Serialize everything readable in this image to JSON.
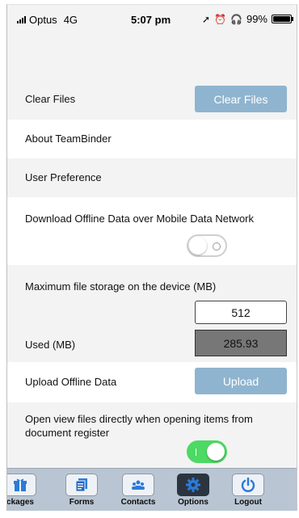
{
  "status_bar": {
    "carrier": "Optus",
    "network": "4G",
    "time": "5:07 pm",
    "battery": "99%",
    "battery_level": 0.99
  },
  "rows": {
    "clear_files": {
      "label": "Clear Files",
      "button": "Clear Files"
    },
    "about": {
      "label": "About TeamBinder"
    },
    "user_preference": {
      "label": "User Preference"
    },
    "download_offline": {
      "label": "Download Offline Data over Mobile Data Network",
      "enabled": false
    },
    "max_storage": {
      "label": "Maximum file storage on the device (MB)",
      "value": "512"
    },
    "used": {
      "label": "Used (MB)",
      "value": "285.93"
    },
    "upload_offline": {
      "label": "Upload Offline Data",
      "button": "Upload"
    },
    "open_view": {
      "label": "Open view files directly when opening items from document register",
      "enabled": true
    }
  },
  "tabs": [
    {
      "label": "ckages",
      "icon": "packages-icon"
    },
    {
      "label": "Forms",
      "icon": "forms-icon"
    },
    {
      "label": "Contacts",
      "icon": "contacts-icon"
    },
    {
      "label": "Options",
      "icon": "gear-icon",
      "active": true
    },
    {
      "label": "Logout",
      "icon": "power-icon"
    }
  ],
  "colors": {
    "accent_button": "#8fb4cf",
    "toggle_on": "#4cd964",
    "tabbar": "#b9c5d2",
    "icon_blue": "#2b7bd8"
  }
}
